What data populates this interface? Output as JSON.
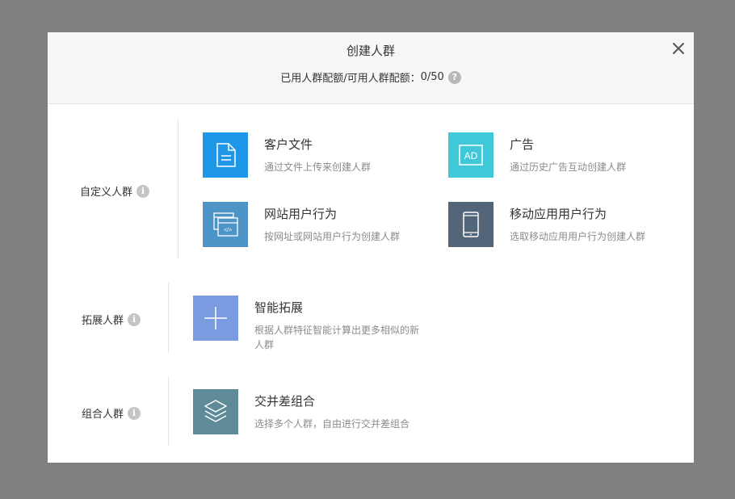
{
  "header": {
    "title": "创建人群",
    "quota_label": "已用人群配额/可用人群配额：",
    "quota_value": "0/50",
    "help_glyph": "?"
  },
  "sections": {
    "custom": {
      "label": "自定义人群",
      "info_glyph": "i",
      "cards": [
        {
          "title": "客户文件",
          "desc": "通过文件上传来创建人群",
          "icon": "document-icon",
          "color": "#1f97e8"
        },
        {
          "title": "广告",
          "desc": "通过历史广告互动创建人群",
          "icon": "ad-icon",
          "ad_text": "AD",
          "color": "#3ec8d8"
        },
        {
          "title": "网站用户行为",
          "desc": "按网址或网站用户行为创建人群",
          "icon": "website-icon",
          "code_text": "</>",
          "color": "#4d95c6"
        },
        {
          "title": "移动应用用户行为",
          "desc": "选取移动应用用户行为创建人群",
          "icon": "mobile-phone-icon",
          "color": "#526579"
        }
      ]
    },
    "expand": {
      "label": "拓展人群",
      "info_glyph": "i",
      "cards": [
        {
          "title": "智能拓展",
          "desc": "根据人群特征智能计算出更多相似的新人群",
          "icon": "plus-icon",
          "color": "#7b9be0"
        }
      ]
    },
    "combine": {
      "label": "组合人群",
      "info_glyph": "i",
      "cards": [
        {
          "title": "交并差组合",
          "desc": "选择多个人群，自由进行交并差组合",
          "icon": "layers-icon",
          "color": "#5f8a97"
        }
      ]
    }
  },
  "colors": {
    "overlay": "#808080",
    "header_bg": "#f6f8f7"
  }
}
